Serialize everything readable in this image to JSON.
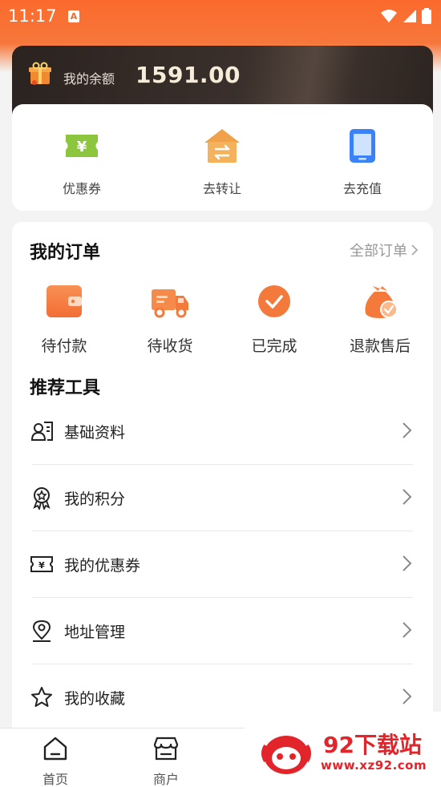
{
  "status_bar": {
    "time": "11:17",
    "notification": "A"
  },
  "balance": {
    "label": "我的余额",
    "value": "1591.00"
  },
  "quick_actions": [
    {
      "label": "优惠券",
      "icon": "coupon-icon"
    },
    {
      "label": "去转让",
      "icon": "transfer-icon"
    },
    {
      "label": "去充值",
      "icon": "recharge-phone-icon"
    }
  ],
  "orders": {
    "title": "我的订单",
    "all_label": "全部订单",
    "items": [
      {
        "label": "待付款",
        "icon": "wallet-icon"
      },
      {
        "label": "待收货",
        "icon": "truck-icon"
      },
      {
        "label": "已完成",
        "icon": "check-circle-icon"
      },
      {
        "label": "退款售后",
        "icon": "money-bag-icon"
      }
    ]
  },
  "tools": {
    "title": "推荐工具",
    "items": [
      {
        "label": "基础资料",
        "icon": "profile-card-icon"
      },
      {
        "label": "我的积分",
        "icon": "medal-icon"
      },
      {
        "label": "我的优惠券",
        "icon": "ticket-icon"
      },
      {
        "label": "地址管理",
        "icon": "location-pin-icon"
      },
      {
        "label": "我的收藏",
        "icon": "star-icon"
      }
    ]
  },
  "tabbar": [
    {
      "label": "首页",
      "icon": "home-icon"
    },
    {
      "label": "商户",
      "icon": "store-icon"
    }
  ],
  "watermark": {
    "title": "92下载站",
    "url": "www.xz92.com"
  },
  "colors": {
    "accent": "#f26a2d",
    "card_dark": "#2b2320",
    "watermark_red": "#e2242b"
  }
}
